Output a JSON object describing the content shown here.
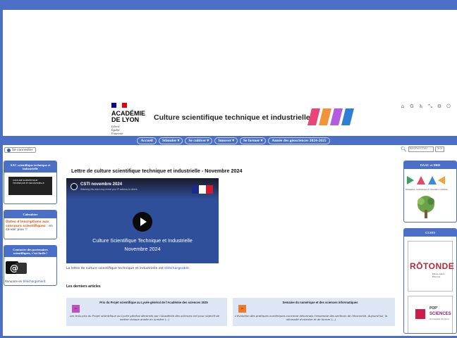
{
  "header": {
    "academy_name": "ACADÉMIE\nDE LYON",
    "motto": "Liberté\nÉgalité\nFraternité",
    "site_title": "Culture scientifique technique et industrielle",
    "stripe_colors": [
      "#e9457a",
      "#f2933a",
      "#b35ce0",
      "#2f7fd0"
    ],
    "tools": [
      "home-icon",
      "google-icon",
      "accessibility-icon",
      "shrink-icon",
      "settings-icon",
      "power-icon"
    ]
  },
  "nav": {
    "items": [
      {
        "label": "Accueil"
      },
      {
        "label": "Stimuler ▾"
      },
      {
        "label": "Se cultiver ▾"
      },
      {
        "label": "Innover ▾"
      },
      {
        "label": "Se former ▾"
      },
      {
        "label": "Année des géosciences 2024-2025"
      }
    ]
  },
  "login": {
    "label": "Se connecter"
  },
  "search": {
    "placeholder": "Rechercher ...",
    "go_label": ">>"
  },
  "left": {
    "box1_title": "SAC scientifique technique et industrielle",
    "box1_thumb": "CULTURE SCIENTIFIQUE TECHNIQUE ET INDUSTRIELLE",
    "box2_title": "Calendrier",
    "box2_highlight": "Dates d'inscriptions aux concours scientifiques",
    "box2_rest": " : en sa-voir plus !!",
    "box3_title": "Contacter des partenaires scientifiques, c'est facile !",
    "box3_text": "Annuaire en ",
    "box3_link": "téléchargement."
  },
  "main": {
    "title": "Lettre de culture scientifique technique et industrielle - Novembre 2024",
    "video_title": "CSTI novembre 2024",
    "video_sub": "Watching this video may reveal your IP address to others.",
    "video_caption_line1": "Culture Scientifique Technique et Industrielle",
    "video_caption_line2": "Novembre 2024",
    "intro_text": "La lettre de culture scientifique technique et industrielle est ",
    "intro_link": "téléchargeable.",
    "section_heading": "Les derniers articles",
    "articles": [
      {
        "title": "Prix du Projet scientifique au Lycée général de l'Académie des sciences 2025",
        "text": "Les trois prix du Projet scientifique au Lycée général décernés par l'Académie des sciences ont pour objectif de mettre chaque année en lumière (...)",
        "icon_color": "#c24fc0",
        "icon_label": "JSI"
      },
      {
        "title": "Semaine du numérique et des sciences informatiques",
        "text": "L'évolution des pratiques numériques concerne désormais l'ensemble des secteurs de l'économie. Aujourd'hui, la nécessité d'orienter et de former (...)",
        "icon_color": "#f07a2a",
        "icon_label": "JSI"
      }
    ]
  },
  "right": {
    "box1_title": "DAAC et DRD",
    "box1_caption": "Délégation académique à l'éducation artistique et à l'action culturelle",
    "box2_title": "CCSTI",
    "tile1_name": "RŌTONDE",
    "tile1_sub": "Mines Saint-Étienne",
    "tile2_line1": "POP'",
    "tile2_line2": "SCIENCES",
    "tile2_line3": "Université de Lyon"
  }
}
